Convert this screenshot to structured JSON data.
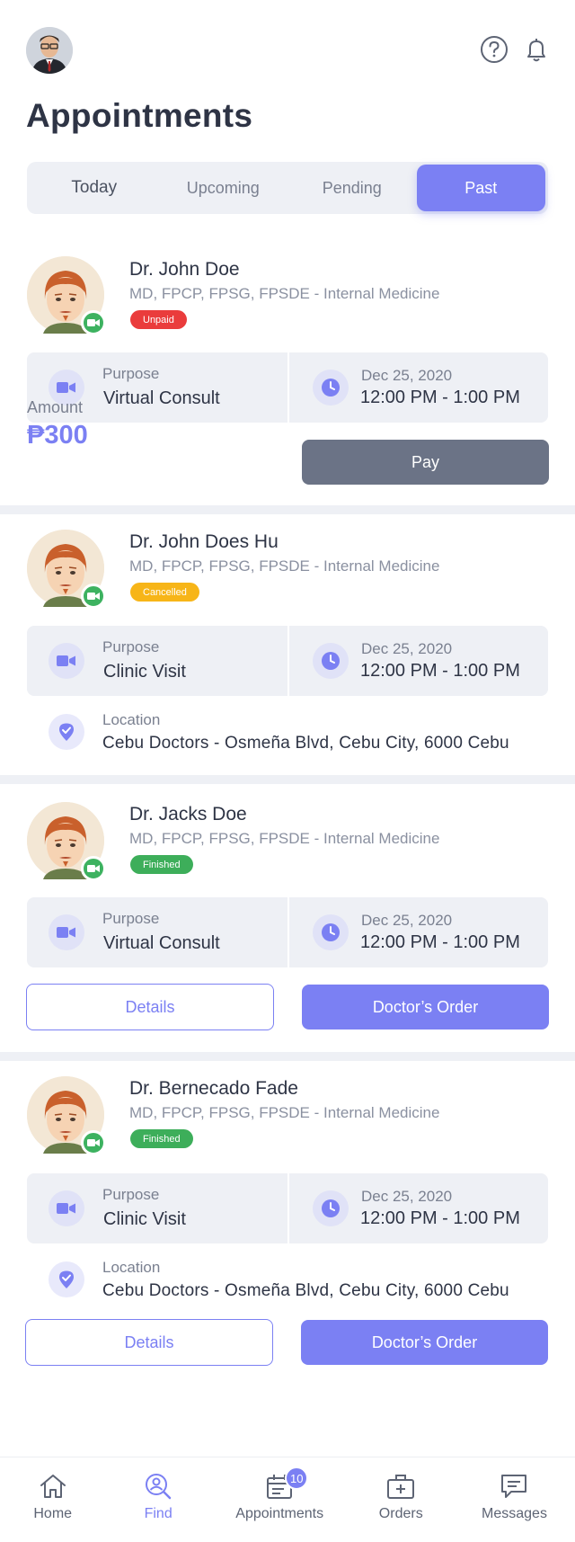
{
  "header": {
    "title": "Appointments",
    "avatar_icon": "user-avatar",
    "help_icon": "help-circle-icon",
    "bell_icon": "bell-icon"
  },
  "tabs": [
    {
      "label": "Today",
      "active": false
    },
    {
      "label": "Upcoming",
      "active": false
    },
    {
      "label": "Pending",
      "active": false
    },
    {
      "label": "Past",
      "active": true
    }
  ],
  "appointments": [
    {
      "doctor": "Dr. John Doe",
      "specialty": "MD, FPCP, FPSG, FPSDE - Internal Medicine",
      "status": "Unpaid",
      "purpose_label": "Purpose",
      "purpose": "Virtual Consult",
      "date": "Dec 25, 2020",
      "time": "12:00 PM - 1:00 PM",
      "amount_label": "Amount",
      "amount": "₱300",
      "pay_label": "Pay"
    },
    {
      "doctor": "Dr. John Does Hu",
      "specialty": "MD, FPCP, FPSG, FPSDE - Internal Medicine",
      "status": "Cancelled",
      "purpose_label": "Purpose",
      "purpose": "Clinic Visit",
      "date": "Dec 25, 2020",
      "time": "12:00 PM - 1:00 PM",
      "location_label": "Location",
      "location": "Cebu Doctors - Osmeña Blvd, Cebu City, 6000 Cebu"
    },
    {
      "doctor": "Dr. Jacks Doe",
      "specialty": "MD, FPCP, FPSG, FPSDE - Internal Medicine",
      "status": "Finished",
      "purpose_label": "Purpose",
      "purpose": "Virtual Consult",
      "date": "Dec 25, 2020",
      "time": "12:00 PM - 1:00 PM",
      "details_label": "Details",
      "order_label": "Doctor’s Order"
    },
    {
      "doctor": "Dr. Bernecado Fade",
      "specialty": "MD, FPCP, FPSG, FPSDE - Internal Medicine",
      "status": "Finished",
      "purpose_label": "Purpose",
      "purpose": "Clinic Visit",
      "date": "Dec 25, 2020",
      "time": "12:00 PM - 1:00 PM",
      "location_label": "Location",
      "location": "Cebu Doctors - Osmeña Blvd, Cebu City, 6000 Cebu",
      "details_label": "Details",
      "order_label": "Doctor’s Order"
    }
  ],
  "bottom_nav": [
    {
      "label": "Home",
      "icon": "home-icon",
      "active": false
    },
    {
      "label": "Find",
      "icon": "find-doctor-icon",
      "active": true
    },
    {
      "label": "Appointments",
      "icon": "calendar-icon",
      "active": false,
      "badge": "10"
    },
    {
      "label": "Orders",
      "icon": "medical-bag-icon",
      "active": false
    },
    {
      "label": "Messages",
      "icon": "message-icon",
      "active": false
    }
  ],
  "colors": {
    "accent": "#7b80f3",
    "unpaid": "#ea3c3c",
    "cancelled": "#f7b518",
    "finished": "#3dae5a",
    "pay_button": "#6b7386"
  }
}
